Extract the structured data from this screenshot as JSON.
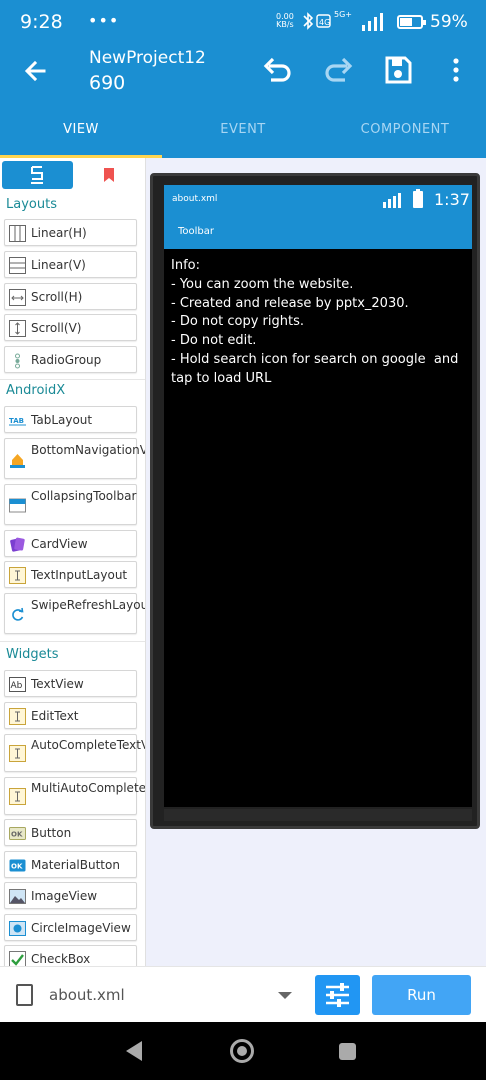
{
  "status": {
    "time": "9:28",
    "dots": "•••",
    "speed_top": "0.00",
    "speed_bottom": "KB/s",
    "net": "5G+",
    "battery_percent": "59%",
    "battery_level": 0.59
  },
  "appbar": {
    "title": "NewProject12",
    "subtitle": "690"
  },
  "tabs": [
    {
      "label": "VIEW",
      "active": true
    },
    {
      "label": "EVENT",
      "active": false
    },
    {
      "label": "COMPONENT",
      "active": false
    }
  ],
  "palette": {
    "sections": {
      "layouts": "Layouts",
      "androidx": "AndroidX",
      "widgets": "Widgets"
    },
    "items": [
      {
        "label": "Linear(H)",
        "icon": "linear-horizontal-icon"
      },
      {
        "label": "Linear(V)",
        "icon": "linear-vertical-icon"
      },
      {
        "label": "Scroll(H)",
        "icon": "scroll-horizontal-icon"
      },
      {
        "label": "Scroll(V)",
        "icon": "scroll-vertical-icon"
      },
      {
        "label": "RadioGroup",
        "icon": "radiogroup-icon"
      },
      {
        "label": "TabLayout",
        "icon": "tablayout-icon"
      },
      {
        "label": "BottomNavigationView",
        "icon": "bottom-navigation-icon"
      },
      {
        "label": "CollapsingToolbar",
        "icon": "collapsing-toolbar-icon"
      },
      {
        "label": "CardView",
        "icon": "cardview-icon"
      },
      {
        "label": "TextInputLayout",
        "icon": "textinputlayout-icon"
      },
      {
        "label": "SwipeRefreshLayout",
        "icon": "swiperefresh-icon"
      },
      {
        "label": "TextView",
        "icon": "textview-icon"
      },
      {
        "label": "EditText",
        "icon": "edittext-icon"
      },
      {
        "label": "AutoCompleteTextView",
        "icon": "autocomplete-icon"
      },
      {
        "label": "MultiAutoCompleteTextView",
        "icon": "multiautocomplete-icon"
      },
      {
        "label": "Button",
        "icon": "button-icon"
      },
      {
        "label": "MaterialButton",
        "icon": "materialbutton-icon"
      },
      {
        "label": "ImageView",
        "icon": "imageview-icon"
      },
      {
        "label": "CircleImageView",
        "icon": "circleimageview-icon"
      },
      {
        "label": "CheckBox",
        "icon": "checkbox-icon"
      }
    ]
  },
  "preview": {
    "file_name": "about.xml",
    "time": "1:37",
    "toolbar_title": "Toolbar",
    "text": "Info:\n- You can zoom the website.\n- Created and release by pptx_2030.\n- Do not copy rights.\n- Do not edit.\n- Hold search icon for search on google  and tap to load URL"
  },
  "bottombar": {
    "file_name": "about.xml",
    "run_label": "Run"
  },
  "colors": {
    "primary": "#1b8fd2",
    "accent": "#ffd54f",
    "section": "#1a8a96",
    "run": "#42a5f5"
  }
}
